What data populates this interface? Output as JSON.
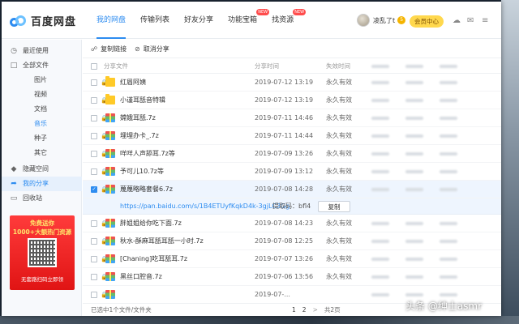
{
  "app": {
    "logo_text": "百度网盘"
  },
  "nav": [
    {
      "label": "我的网盘",
      "new": ""
    },
    {
      "label": "传输列表",
      "new": ""
    },
    {
      "label": "好友分享",
      "new": ""
    },
    {
      "label": "功能宝箱",
      "new": "NEW"
    },
    {
      "label": "找资源",
      "new": "NEW"
    }
  ],
  "user": {
    "name": "凌乱了t",
    "vip_level": "5",
    "member_button": "会员中心"
  },
  "sidebar": {
    "items": [
      {
        "label": "最近使用",
        "icon": "clock-icon"
      },
      {
        "label": "全部文件",
        "icon": "folder-icon"
      },
      {
        "label": "图片",
        "icon": ""
      },
      {
        "label": "视频",
        "icon": ""
      },
      {
        "label": "文档",
        "icon": ""
      },
      {
        "label": "音乐",
        "icon": ""
      },
      {
        "label": "种子",
        "icon": ""
      },
      {
        "label": "其它",
        "icon": ""
      },
      {
        "label": "隐藏空间",
        "icon": "lock-icon"
      },
      {
        "label": "我的分享",
        "icon": "share-icon"
      },
      {
        "label": "回收站",
        "icon": "trash-icon"
      }
    ],
    "selected": "我的分享",
    "promo": {
      "line1": "免费送你",
      "line2": "1000+大额热门资源",
      "line3": "无套路扫码立即领"
    }
  },
  "toolbar": {
    "copy_link": "复制链接",
    "cancel_share": "取消分享"
  },
  "columns": {
    "name": "分享文件",
    "time": "分享时间",
    "validity": "失效时间"
  },
  "files": [
    {
      "name": "红眉阿姨",
      "type": "folder",
      "time": "2019-07-12 13:19",
      "validity": "永久有效",
      "checked": false
    },
    {
      "name": "小谨耳舐音特辑",
      "type": "folder",
      "time": "2019-07-12 13:19",
      "validity": "永久有效",
      "checked": false
    },
    {
      "name": "嫦娥耳舐.7z",
      "type": "zip",
      "time": "2019-07-11 14:46",
      "validity": "永久有效",
      "checked": false
    },
    {
      "name": "埋埋办卡_.7z",
      "type": "zip",
      "time": "2019-07-11 14:44",
      "validity": "永久有效",
      "checked": false
    },
    {
      "name": "咩咩人声舔耳.7z等",
      "type": "zip",
      "time": "2019-07-09 13:26",
      "validity": "永久有效",
      "checked": false
    },
    {
      "name": "予可儿10.7z等",
      "type": "zip",
      "time": "2019-07-09 13:12",
      "validity": "永久有效",
      "checked": false
    },
    {
      "name": "蔑蔑略略套餐6.7z",
      "type": "zip",
      "time": "2019-07-08 14:28",
      "validity": "永久有效",
      "checked": true
    }
  ],
  "share_link": {
    "url": "https://pan.baidu.com/s/1B4ETUyfKqkD4k-3gjLC3Gg",
    "code_label": "提取码：bfl4",
    "copy_button": "复制"
  },
  "files_after": [
    {
      "name": "胖姐姐给你吃下面.7z",
      "type": "zip",
      "time": "2019-07-08 14:23",
      "validity": "永久有效",
      "checked": false
    },
    {
      "name": "秋水-酥麻耳舐耳舐一小时.7z",
      "type": "zip",
      "time": "2019-07-08 12:25",
      "validity": "永久有效",
      "checked": false
    },
    {
      "name": "[Chaning]吃耳舐耳.7z",
      "type": "zip",
      "time": "2019-07-07 13:26",
      "validity": "永久有效",
      "checked": false
    },
    {
      "name": "黑丝口腔音.7z",
      "type": "zip",
      "time": "2019-07-06 13:56",
      "validity": "永久有效",
      "checked": false
    },
    {
      "name": "",
      "type": "zip",
      "time": "2019-07-...",
      "validity": "",
      "checked": false
    }
  ],
  "footer": {
    "status": "已选中1个文件/文件夹",
    "page1": "1",
    "page2": "2",
    "next": ">",
    "total": "共2页"
  },
  "watermark": "头条 @绅士asmr"
}
